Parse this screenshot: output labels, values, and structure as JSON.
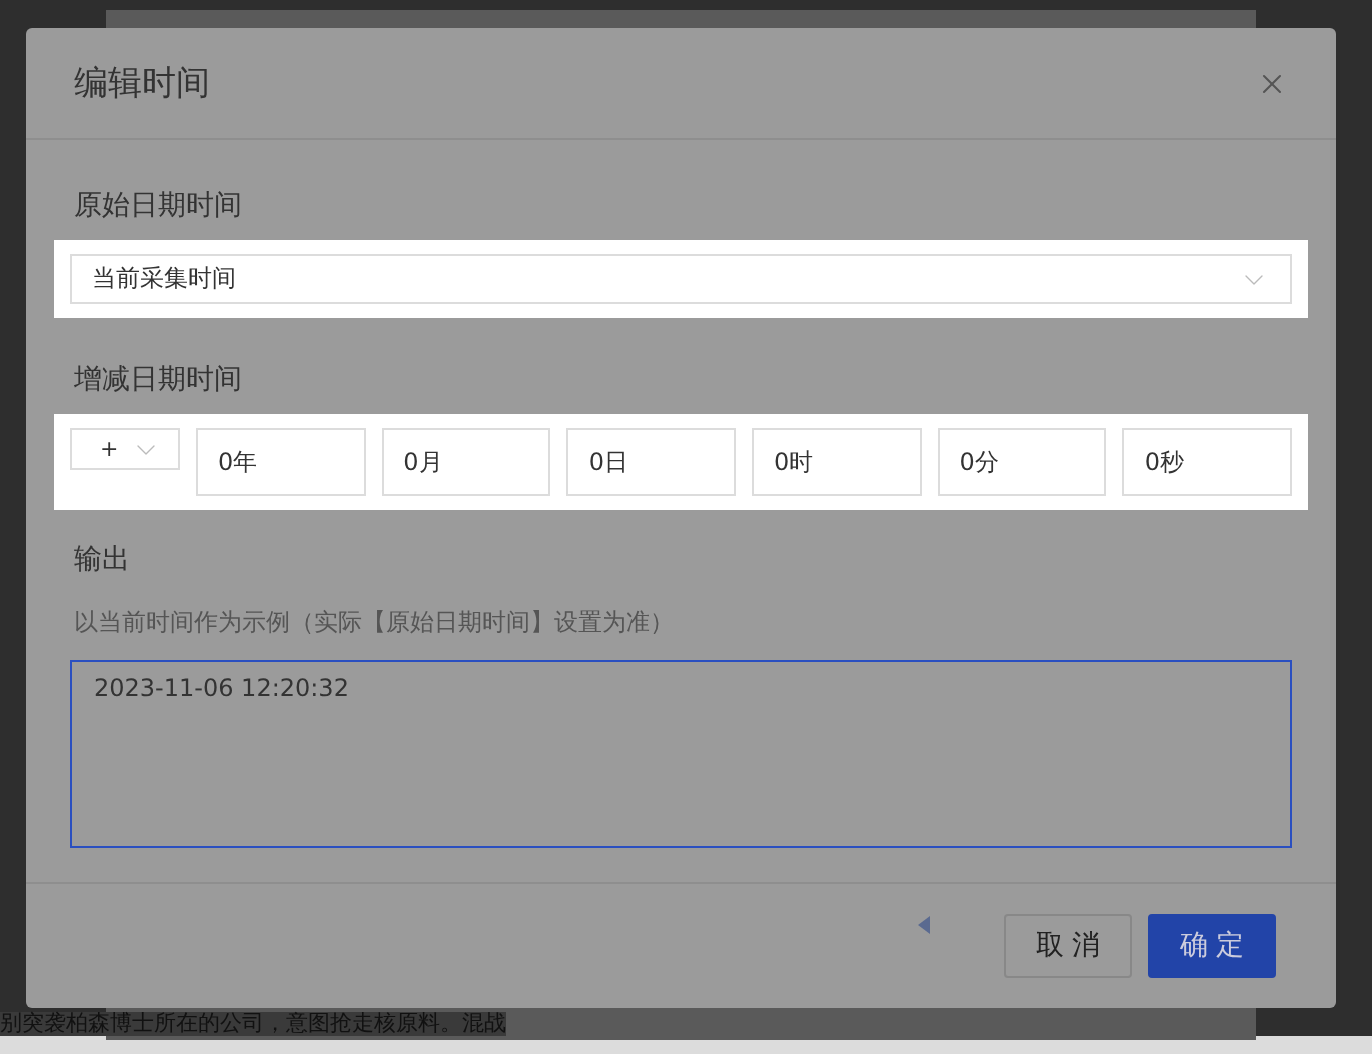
{
  "background": {
    "bottom_text": "别突袭柏森博士所在的公司，意图抢走核原料。混战"
  },
  "dialog": {
    "title": "编辑时间",
    "original": {
      "label": "原始日期时间",
      "value": "当前采集时间",
      "highlighted": true
    },
    "offset": {
      "label": "增减日期时间",
      "sign": "+",
      "highlighted": true,
      "fields": [
        "0年",
        "0月",
        "0日",
        "0时",
        "0分",
        "0秒"
      ]
    },
    "output": {
      "label": "输出",
      "hint": "以当前时间作为示例（实际【原始日期时间】设置为准）",
      "value": "2023-11-06 12:20:32"
    },
    "buttons": [
      {
        "label": "取 消",
        "kind": "secondary"
      },
      {
        "label": "确 定",
        "kind": "primary"
      }
    ]
  }
}
